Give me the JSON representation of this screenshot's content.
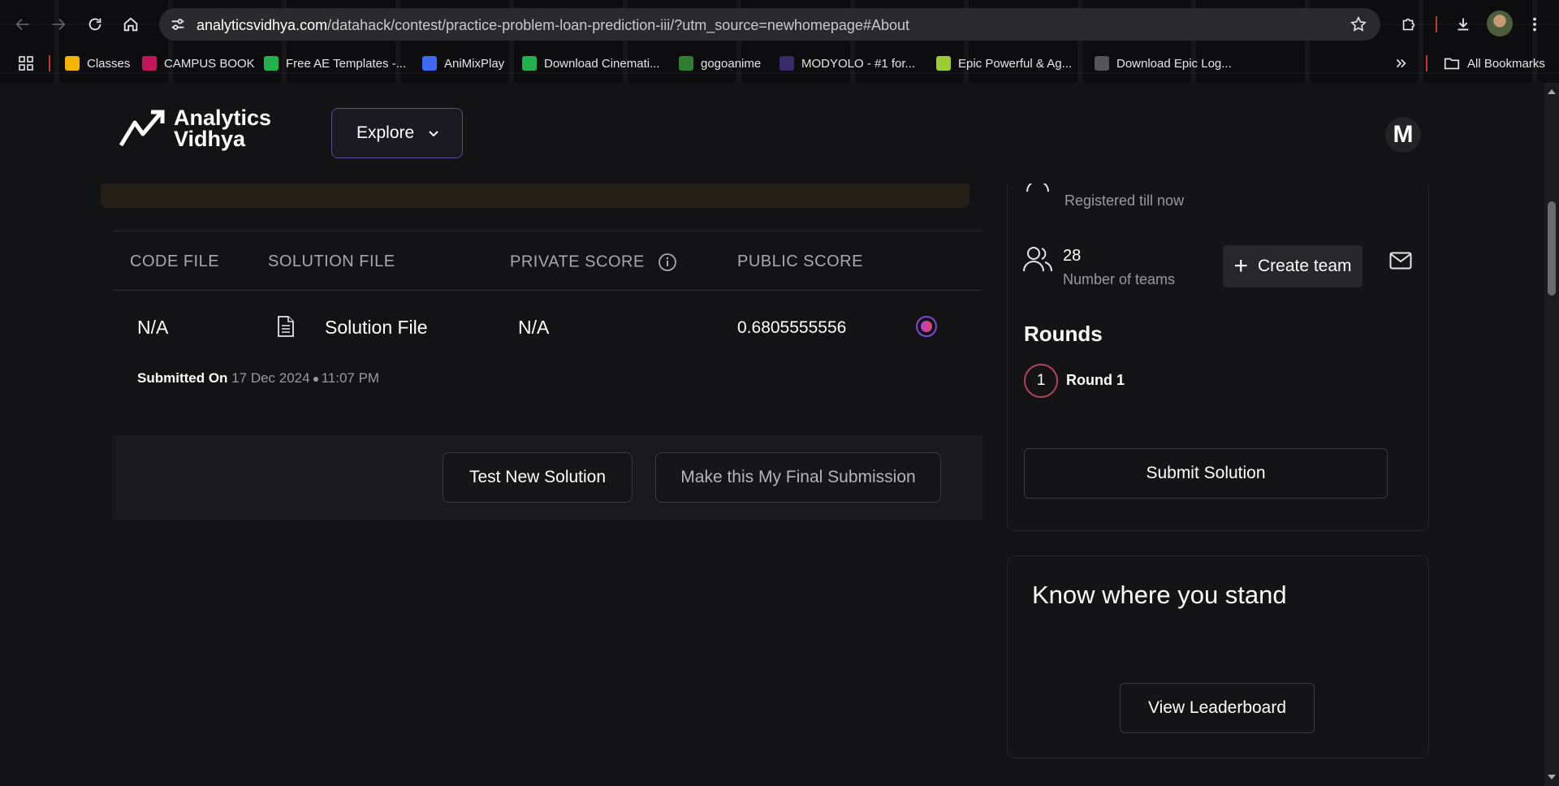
{
  "browser": {
    "url_domain": "analyticsvidhya.com",
    "url_path": "/datahack/contest/practice-problem-loan-prediction-iii/?utm_source=newhomepage#About",
    "bookmarks": [
      {
        "label": "Classes",
        "color": "#f4b400"
      },
      {
        "label": "CAMPUS BOOK",
        "color": "#c2185b"
      },
      {
        "label": "Free AE Templates -...",
        "color": "#22b14c"
      },
      {
        "label": "AniMixPlay",
        "color": "#3d6af2"
      },
      {
        "label": "Download Cinemati...",
        "color": "#22b14c"
      },
      {
        "label": "gogoanime",
        "color": "#2e7d32"
      },
      {
        "label": "MODYOLO - #1 for...",
        "color": "#3a2a6b"
      },
      {
        "label": "Epic Powerful & Ag...",
        "color": "#9acd32"
      },
      {
        "label": "Download Epic Log...",
        "color": "#555555"
      }
    ],
    "all_bookmarks": "All Bookmarks"
  },
  "header": {
    "logo_line1": "Analytics",
    "logo_line2": "Vidhya",
    "explore_label": "Explore",
    "user_initial": "M"
  },
  "table": {
    "headers": {
      "code_file": "CODE FILE",
      "solution_file": "SOLUTION FILE",
      "private_score": "PRIVATE SCORE",
      "public_score": "PUBLIC SCORE"
    },
    "row": {
      "code_file": "N/A",
      "solution_file": "Solution File",
      "private_score": "N/A",
      "public_score": "0.6805555556"
    },
    "submitted_label": "Submitted On",
    "submitted_date": "17 Dec 2024",
    "submitted_time": "11:07 PM"
  },
  "actions": {
    "test_new": "Test New Solution",
    "final_submission": "Make this My Final Submission"
  },
  "sidebar": {
    "registered_label": "Registered till now",
    "teams_count": "28",
    "teams_label": "Number of teams",
    "create_team": "Create team",
    "rounds_title": "Rounds",
    "round_number": "1",
    "round_label": "Round 1",
    "submit_solution": "Submit Solution"
  },
  "leaderboard": {
    "title": "Know where you stand",
    "button": "View Leaderboard"
  }
}
